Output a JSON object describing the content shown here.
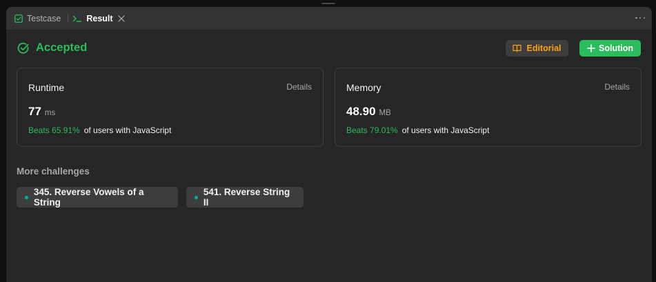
{
  "tabs": [
    {
      "label": "Testcase",
      "icon": "checkbox-icon"
    },
    {
      "label": "Result",
      "icon": "terminal-icon"
    }
  ],
  "status": {
    "label": "Accepted",
    "color": "#2cbb5d"
  },
  "actions": {
    "editorial_label": "Editorial",
    "solution_label": "Solution"
  },
  "runtime": {
    "title": "Runtime",
    "details": "Details",
    "value": "77",
    "unit": "ms",
    "beats": "Beats 65.91%",
    "suffix": "of users with JavaScript"
  },
  "memory": {
    "title": "Memory",
    "details": "Details",
    "value": "48.90",
    "unit": "MB",
    "beats": "Beats 79.01%",
    "suffix": "of users with JavaScript"
  },
  "more_challenges": {
    "heading": "More challenges",
    "items": [
      "345. Reverse Vowels of a String",
      "541. Reverse String II"
    ]
  },
  "colors": {
    "accent_green": "#2cbb5d",
    "accent_orange": "#ffa116",
    "dot_teal": "#00af9b"
  }
}
